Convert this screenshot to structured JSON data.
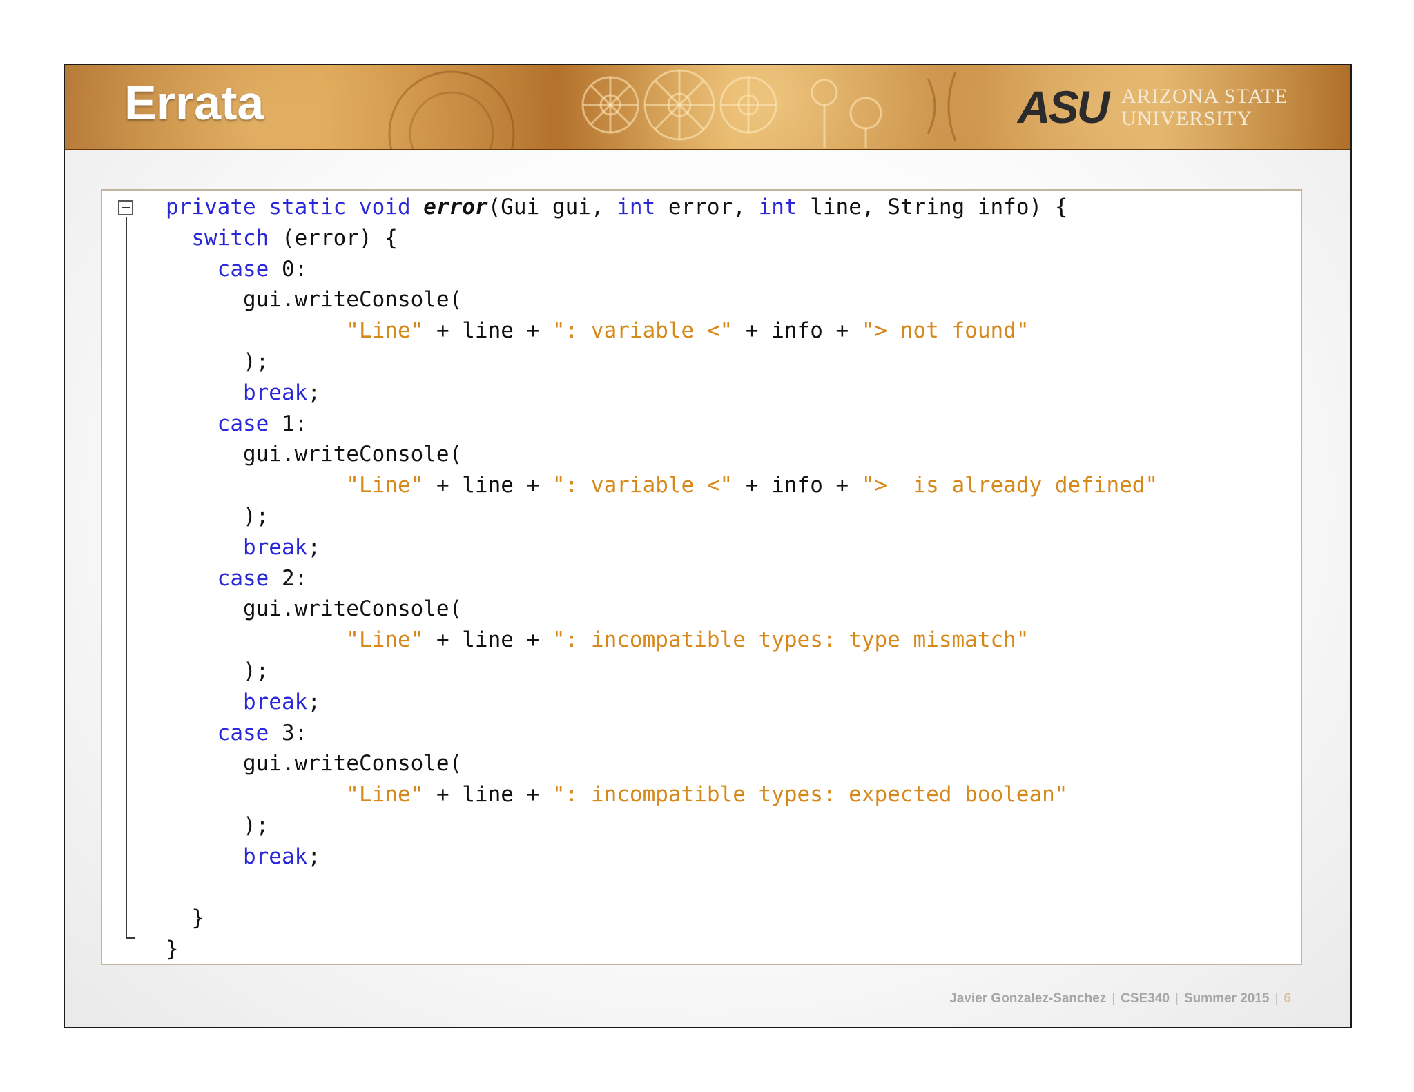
{
  "slide": {
    "title": "Errata",
    "logo": {
      "mark": "ASU",
      "line1": "ARIZONA STATE",
      "line2": "UNIVERSITY"
    }
  },
  "code": {
    "lines": [
      [
        {
          "t": "private static void ",
          "c": "kw"
        },
        {
          "t": "error",
          "c": "mth"
        },
        {
          "t": "(Gui gui, ",
          "c": ""
        },
        {
          "t": "int",
          "c": "kw"
        },
        {
          "t": " error, ",
          "c": ""
        },
        {
          "t": "int",
          "c": "kw"
        },
        {
          "t": " line, String info) {",
          "c": ""
        }
      ],
      [
        {
          "t": "  ",
          "c": ""
        },
        {
          "t": "switch",
          "c": "kw"
        },
        {
          "t": " (error) {",
          "c": ""
        }
      ],
      [
        {
          "t": "    ",
          "c": ""
        },
        {
          "t": "case",
          "c": "kw"
        },
        {
          "t": " 0:",
          "c": ""
        }
      ],
      [
        {
          "t": "      gui.writeConsole(",
          "c": ""
        }
      ],
      [
        {
          "t": "              ",
          "c": ""
        },
        {
          "t": "\"Line\"",
          "c": "str"
        },
        {
          "t": " + line + ",
          "c": ""
        },
        {
          "t": "\": variable <\"",
          "c": "str"
        },
        {
          "t": " + info + ",
          "c": ""
        },
        {
          "t": "\"> not found\"",
          "c": "str"
        }
      ],
      [
        {
          "t": "      );",
          "c": ""
        }
      ],
      [
        {
          "t": "      ",
          "c": ""
        },
        {
          "t": "break",
          "c": "kw"
        },
        {
          "t": ";",
          "c": ""
        }
      ],
      [
        {
          "t": "    ",
          "c": ""
        },
        {
          "t": "case",
          "c": "kw"
        },
        {
          "t": " 1:",
          "c": ""
        }
      ],
      [
        {
          "t": "      gui.writeConsole(",
          "c": ""
        }
      ],
      [
        {
          "t": "              ",
          "c": ""
        },
        {
          "t": "\"Line\"",
          "c": "str"
        },
        {
          "t": " + line + ",
          "c": ""
        },
        {
          "t": "\": variable <\"",
          "c": "str"
        },
        {
          "t": " + info + ",
          "c": ""
        },
        {
          "t": "\">  is already defined\"",
          "c": "str"
        }
      ],
      [
        {
          "t": "      );",
          "c": ""
        }
      ],
      [
        {
          "t": "      ",
          "c": ""
        },
        {
          "t": "break",
          "c": "kw"
        },
        {
          "t": ";",
          "c": ""
        }
      ],
      [
        {
          "t": "    ",
          "c": ""
        },
        {
          "t": "case",
          "c": "kw"
        },
        {
          "t": " 2:",
          "c": ""
        }
      ],
      [
        {
          "t": "      gui.writeConsole(",
          "c": ""
        }
      ],
      [
        {
          "t": "              ",
          "c": ""
        },
        {
          "t": "\"Line\"",
          "c": "str"
        },
        {
          "t": " + line + ",
          "c": ""
        },
        {
          "t": "\": incompatible types: type mismatch\"",
          "c": "str"
        }
      ],
      [
        {
          "t": "      );",
          "c": ""
        }
      ],
      [
        {
          "t": "      ",
          "c": ""
        },
        {
          "t": "break",
          "c": "kw"
        },
        {
          "t": ";",
          "c": ""
        }
      ],
      [
        {
          "t": "    ",
          "c": ""
        },
        {
          "t": "case",
          "c": "kw"
        },
        {
          "t": " 3:",
          "c": ""
        }
      ],
      [
        {
          "t": "      gui.writeConsole(",
          "c": ""
        }
      ],
      [
        {
          "t": "              ",
          "c": ""
        },
        {
          "t": "\"Line\"",
          "c": "str"
        },
        {
          "t": " + line + ",
          "c": ""
        },
        {
          "t": "\": incompatible types: expected boolean\"",
          "c": "str"
        }
      ],
      [
        {
          "t": "      );",
          "c": ""
        }
      ],
      [
        {
          "t": "      ",
          "c": ""
        },
        {
          "t": "break",
          "c": "kw"
        },
        {
          "t": ";",
          "c": ""
        }
      ],
      [
        {
          "t": "",
          "c": ""
        }
      ],
      [
        {
          "t": "  }",
          "c": ""
        }
      ],
      [
        {
          "t": "}",
          "c": ""
        }
      ]
    ]
  },
  "footer": {
    "author": "Javier Gonzalez-Sanchez",
    "course": "CSE340",
    "term": "Summer 2015",
    "page": "6"
  },
  "colors": {
    "keyword": "#2a28d6",
    "string": "#d7881a",
    "text": "#111111"
  }
}
